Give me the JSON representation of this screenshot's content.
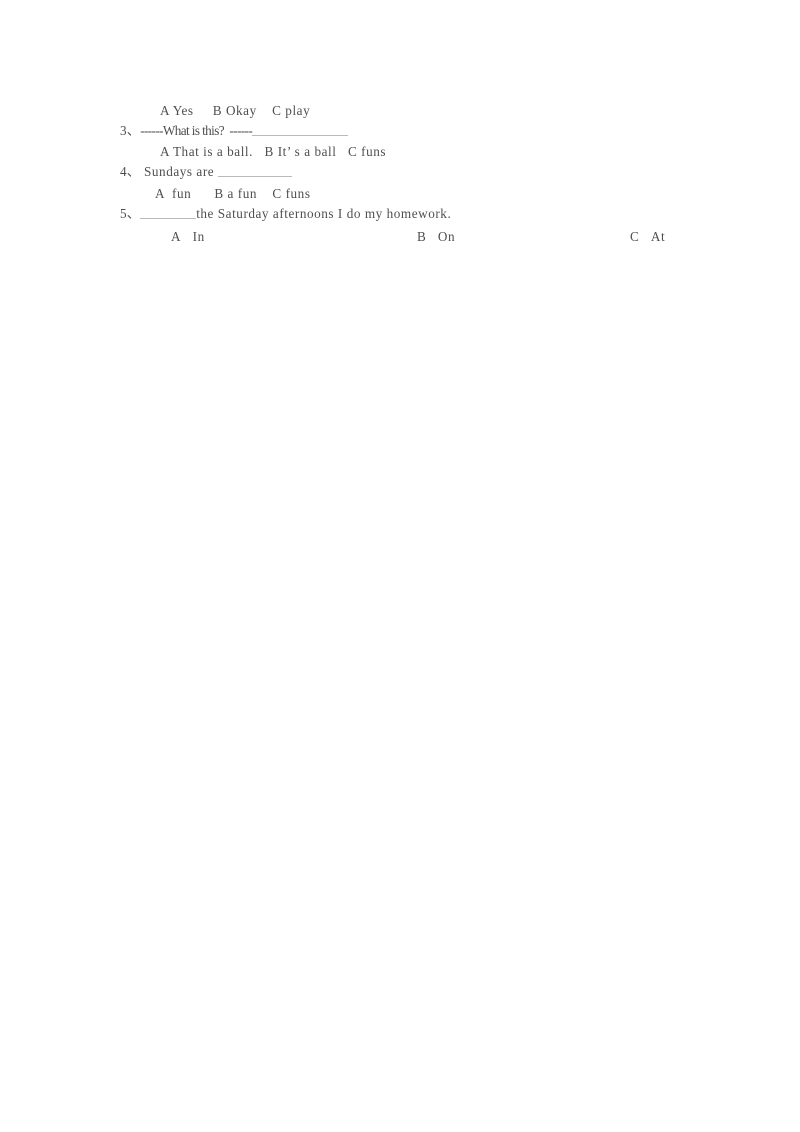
{
  "document": {
    "type": "scanned-worksheet",
    "background_color": "#ffffff",
    "text_color": "#3f3f3f",
    "rule_color": "#b4b4b4"
  },
  "questions": {
    "q2": {
      "options_line": "A Yes     B Okay    C play"
    },
    "q3": {
      "number": "3、",
      "stem_before_blank": "------What is this?  ------",
      "options_line": "A That is a ball.   B It’ s a ball   C funs"
    },
    "q4": {
      "number": "4、",
      "stem_before_blank": " Sundays are ",
      "options_line": "A  fun      B a fun    C funs"
    },
    "q5": {
      "number": "5、",
      "stem_after_blank": "the Saturday afternoons I do my homework.",
      "options": [
        {
          "label": "A",
          "text": "In"
        },
        {
          "label": "B",
          "text": "On"
        },
        {
          "label": "C",
          "text": "At"
        }
      ]
    }
  }
}
